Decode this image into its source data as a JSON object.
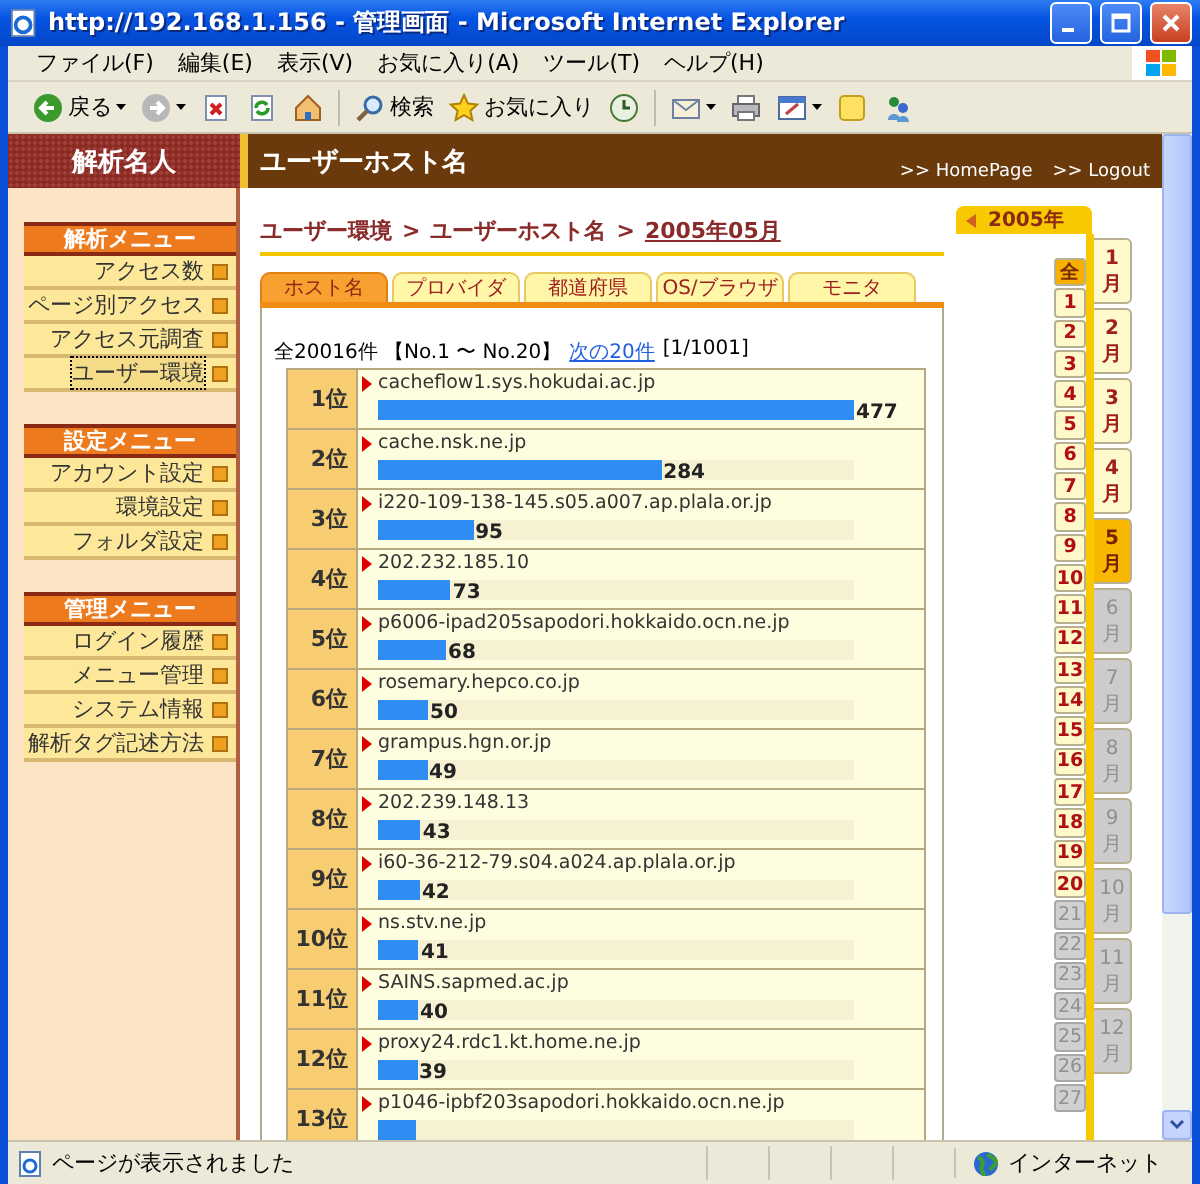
{
  "window": {
    "title": "http://192.168.1.156 - 管理画面 - Microsoft Internet Explorer"
  },
  "menu": [
    "ファイル(F)",
    "編集(E)",
    "表示(V)",
    "お気に入り(A)",
    "ツール(T)",
    "ヘルプ(H)"
  ],
  "toolbar": [
    {
      "kind": "back",
      "label": "戻る",
      "dropdown": true
    },
    {
      "kind": "forward",
      "dropdown": true
    },
    {
      "kind": "stop",
      "dropdown": false
    },
    {
      "kind": "refresh",
      "dropdown": false
    },
    {
      "kind": "home",
      "dropdown": false
    },
    {
      "kind": "search",
      "label": "検索",
      "dropdown": false
    },
    {
      "kind": "favorites",
      "label": "お気に入り",
      "dropdown": false
    },
    {
      "kind": "history",
      "dropdown": false
    },
    {
      "kind": "mail",
      "dropdown": true
    },
    {
      "kind": "print",
      "dropdown": false
    },
    {
      "kind": "edit",
      "dropdown": true
    },
    {
      "kind": "note",
      "dropdown": false
    },
    {
      "kind": "messenger",
      "dropdown": false
    }
  ],
  "sidebar": {
    "title": "解析名人",
    "sections": [
      {
        "title": "解析メニュー",
        "items": [
          {
            "label": "アクセス数",
            "selected": false
          },
          {
            "label": "ページ別アクセス",
            "selected": false
          },
          {
            "label": "アクセス元調査",
            "selected": false
          },
          {
            "label": "ユーザー環境",
            "selected": true
          }
        ]
      },
      {
        "title": "設定メニュー",
        "items": [
          {
            "label": "アカウント設定",
            "selected": false
          },
          {
            "label": "環境設定",
            "selected": false
          },
          {
            "label": "フォルダ設定",
            "selected": false
          }
        ]
      },
      {
        "title": "管理メニュー",
        "items": [
          {
            "label": "ログイン履歴",
            "selected": false
          },
          {
            "label": "メニュー管理",
            "selected": false
          },
          {
            "label": "システム情報",
            "selected": false
          },
          {
            "label": "解析タグ記述方法",
            "selected": false
          }
        ]
      }
    ]
  },
  "header": {
    "title": "ユーザーホスト名",
    "links": [
      ">> HomePage",
      ">> Logout"
    ]
  },
  "breadcrumb": {
    "separator": ">",
    "items": [
      {
        "label": "ユーザー環境",
        "kind": "text"
      },
      {
        "label": "ユーザーホスト名",
        "kind": "text"
      },
      {
        "label": "2005年05月",
        "kind": "link"
      }
    ]
  },
  "tabs": [
    {
      "label": "ホスト名",
      "selected": true
    },
    {
      "label": "プロバイダ",
      "selected": false
    },
    {
      "label": "都道府県",
      "selected": false
    },
    {
      "label": "OS/ブラウザ",
      "selected": false
    },
    {
      "label": "モニタ",
      "selected": false
    }
  ],
  "summary": {
    "text": "全20016件 【No.1 〜 No.20】",
    "next_link": "次の20件",
    "page": "[1/1001]"
  },
  "rows": [
    {
      "rank": "1位",
      "host": "cacheflow1.sys.hokudai.ac.jp",
      "count": "477",
      "level": 1
    },
    {
      "rank": "2位",
      "host": "cache.nsk.ne.jp",
      "count": "284",
      "level": 0.595
    },
    {
      "rank": "3位",
      "host": "i220-109-138-145.s05.a007.ap.plala.or.jp",
      "count": "95",
      "level": 0.2
    },
    {
      "rank": "4位",
      "host": "202.232.185.10",
      "count": "73",
      "level": 0.153
    },
    {
      "rank": "5位",
      "host": "p6006-ipad205sapodori.hokkaido.ocn.ne.jp",
      "count": "68",
      "level": 0.143
    },
    {
      "rank": "6位",
      "host": "rosemary.hepco.co.jp",
      "count": "50",
      "level": 0.105
    },
    {
      "rank": "7位",
      "host": "grampus.hgn.or.jp",
      "count": "49",
      "level": 0.103
    },
    {
      "rank": "8位",
      "host": "202.239.148.13",
      "count": "43",
      "level": 0.09
    },
    {
      "rank": "9位",
      "host": "i60-36-212-79.s04.a024.ap.plala.or.jp",
      "count": "42",
      "level": 0.088
    },
    {
      "rank": "10位",
      "host": "ns.stv.ne.jp",
      "count": "41",
      "level": 0.086
    },
    {
      "rank": "11位",
      "host": "SAINS.sapmed.ac.jp",
      "count": "40",
      "level": 0.084
    },
    {
      "rank": "12位",
      "host": "proxy24.rdc1.kt.home.ne.jp",
      "count": "39",
      "level": 0.082
    },
    {
      "rank": "13位",
      "host": "p1046-ipbf203sapodori.hokkaido.ocn.ne.jp",
      "level": 0.08
    }
  ],
  "calendar": {
    "year": "2005年",
    "days": [
      {
        "label": "全",
        "enabled": true,
        "selected": true
      },
      {
        "label": "1",
        "enabled": true,
        "selected": false
      },
      {
        "label": "2",
        "enabled": true,
        "selected": false
      },
      {
        "label": "3",
        "enabled": true,
        "selected": false
      },
      {
        "label": "4",
        "enabled": true,
        "selected": false
      },
      {
        "label": "5",
        "enabled": true,
        "selected": false
      },
      {
        "label": "6",
        "enabled": true,
        "selected": false
      },
      {
        "label": "7",
        "enabled": true,
        "selected": false
      },
      {
        "label": "8",
        "enabled": true,
        "selected": false
      },
      {
        "label": "9",
        "enabled": true,
        "selected": false
      },
      {
        "label": "10",
        "enabled": true,
        "selected": false
      },
      {
        "label": "11",
        "enabled": true,
        "selected": false
      },
      {
        "label": "12",
        "enabled": true,
        "selected": false
      },
      {
        "label": "13",
        "enabled": true,
        "selected": false
      },
      {
        "label": "14",
        "enabled": true,
        "selected": false
      },
      {
        "label": "15",
        "enabled": true,
        "selected": false
      },
      {
        "label": "16",
        "enabled": true,
        "selected": false
      },
      {
        "label": "17",
        "enabled": true,
        "selected": false
      },
      {
        "label": "18",
        "enabled": true,
        "selected": false
      },
      {
        "label": "19",
        "enabled": true,
        "selected": false
      },
      {
        "label": "20",
        "enabled": true,
        "selected": false
      },
      {
        "label": "21",
        "enabled": false,
        "selected": false
      },
      {
        "label": "22",
        "enabled": false,
        "selected": false
      },
      {
        "label": "23",
        "enabled": false,
        "selected": false
      },
      {
        "label": "24",
        "enabled": false,
        "selected": false
      },
      {
        "label": "25",
        "enabled": false,
        "selected": false
      },
      {
        "label": "26",
        "enabled": false,
        "selected": false
      },
      {
        "label": "27",
        "enabled": false,
        "selected": false
      }
    ],
    "months": [
      {
        "number": "1",
        "unit": "月",
        "enabled": true,
        "selected": false
      },
      {
        "number": "2",
        "unit": "月",
        "enabled": true,
        "selected": false
      },
      {
        "number": "3",
        "unit": "月",
        "enabled": true,
        "selected": false
      },
      {
        "number": "4",
        "unit": "月",
        "enabled": true,
        "selected": false
      },
      {
        "number": "5",
        "unit": "月",
        "enabled": true,
        "selected": true
      },
      {
        "number": "6",
        "unit": "月",
        "enabled": false,
        "selected": false
      },
      {
        "number": "7",
        "unit": "月",
        "enabled": false,
        "selected": false
      },
      {
        "number": "8",
        "unit": "月",
        "enabled": false,
        "selected": false
      },
      {
        "number": "9",
        "unit": "月",
        "enabled": false,
        "selected": false
      },
      {
        "number": "10",
        "unit": "月",
        "enabled": false,
        "selected": false
      },
      {
        "number": "11",
        "unit": "月",
        "enabled": false,
        "selected": false
      },
      {
        "number": "12",
        "unit": "月",
        "enabled": false,
        "selected": false
      }
    ]
  },
  "status_bar": {
    "text": "ページが表示されました",
    "zone": "インターネット"
  }
}
